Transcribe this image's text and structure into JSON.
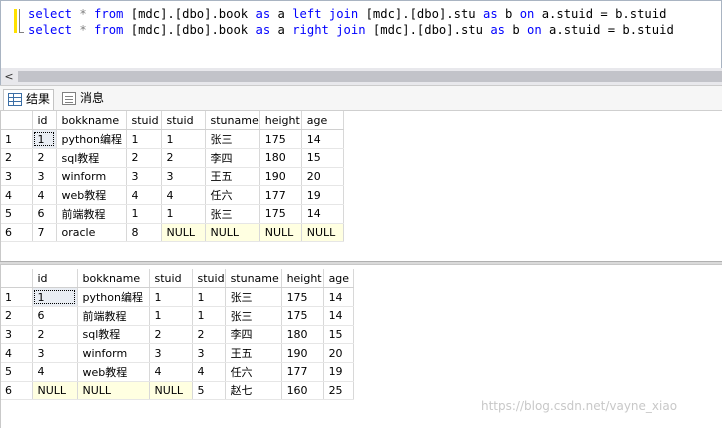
{
  "editor": {
    "line1": [
      "select",
      " * ",
      "from",
      " [mdc].[dbo].book ",
      "as",
      " a ",
      "left join",
      " [mdc].[dbo].stu ",
      "as",
      " b ",
      "on",
      " a.stuid = b.stuid"
    ],
    "line2": [
      "select",
      " * ",
      "from",
      " [mdc].[dbo].book ",
      "as",
      " a ",
      "right join",
      " [mdc].[dbo].stu ",
      "as",
      " b ",
      "on",
      " a.stuid = b.stuid"
    ]
  },
  "scrollbar": {
    "left_arrow": "<"
  },
  "tabs": {
    "results": "结果",
    "messages": "消息"
  },
  "grid1": {
    "columns": [
      "",
      "id",
      "bokkname",
      "stuid",
      "stuid",
      "stuname",
      "height",
      "age"
    ],
    "rows": [
      [
        "1",
        "1",
        "python编程",
        "1",
        "1",
        "张三",
        "175",
        "14"
      ],
      [
        "2",
        "2",
        "sql教程",
        "2",
        "2",
        "李四",
        "180",
        "15"
      ],
      [
        "3",
        "3",
        "winform",
        "3",
        "3",
        "王五",
        "190",
        "20"
      ],
      [
        "4",
        "4",
        "web教程",
        "4",
        "4",
        "任六",
        "177",
        "19"
      ],
      [
        "5",
        "6",
        "前端教程",
        "1",
        "1",
        "张三",
        "175",
        "14"
      ],
      [
        "6",
        "7",
        "oracle",
        "8",
        "NULL",
        "NULL",
        "NULL",
        "NULL"
      ]
    ]
  },
  "grid2": {
    "columns": [
      "",
      "id",
      "bokkname",
      "stuid",
      "stuid",
      "stuname",
      "height",
      "age"
    ],
    "rows": [
      [
        "1",
        "1",
        "python编程",
        "1",
        "1",
        "张三",
        "175",
        "14"
      ],
      [
        "2",
        "6",
        "前端教程",
        "1",
        "1",
        "张三",
        "175",
        "14"
      ],
      [
        "3",
        "2",
        "sql教程",
        "2",
        "2",
        "李四",
        "180",
        "15"
      ],
      [
        "4",
        "3",
        "winform",
        "3",
        "3",
        "王五",
        "190",
        "20"
      ],
      [
        "5",
        "4",
        "web教程",
        "4",
        "4",
        "任六",
        "177",
        "19"
      ],
      [
        "6",
        "NULL",
        "NULL",
        "NULL",
        "5",
        "赵七",
        "160",
        "25"
      ]
    ]
  },
  "watermark": "https://blog.csdn.net/vayne_xiao",
  "colors": {
    "keyword": "#0000ff",
    "null_cell": "#ffffe1",
    "gutter_mark": "#ffe100"
  }
}
